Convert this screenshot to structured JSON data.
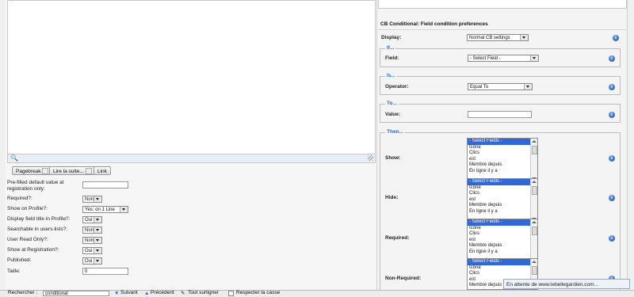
{
  "editor": {
    "buttons": [
      "Pagebreak",
      "Lire la suite...",
      "Link"
    ]
  },
  "left_fields": [
    {
      "label": "Pre-filled default value at registration only:",
      "type": "text",
      "value": ""
    },
    {
      "label": "Required?:",
      "type": "select",
      "value": "Non"
    },
    {
      "label": "Show on Profile?:",
      "type": "select",
      "value": "Yes: on 1 Line"
    },
    {
      "label": "Display field title in Profile?:",
      "type": "select",
      "value": "Oui"
    },
    {
      "label": "Searchable in users-lists?:",
      "type": "select",
      "value": "Non"
    },
    {
      "label": "User Read Only?:",
      "type": "select",
      "value": "Non"
    },
    {
      "label": "Show at Registration?:",
      "type": "select",
      "value": "Oui"
    },
    {
      "label": "Published:",
      "type": "select",
      "value": "Oui"
    },
    {
      "label": "Taille:",
      "type": "text",
      "value": "0"
    }
  ],
  "right": {
    "title": "CB Conditional: Field condition preferences",
    "display_label": "Display:",
    "display_value": "Normal CB settings",
    "if_legend": "If...",
    "field_label": "Field:",
    "field_value": "- Select Field -",
    "is_legend": "Is...",
    "operator_label": "Operator:",
    "operator_value": "Equal To",
    "to_legend": "To...",
    "value_label": "Value:",
    "value_value": "",
    "then_legend": "Then...",
    "lists": [
      {
        "label": "Show:",
        "items": [
          "- Select Fields -",
          "Icône",
          "Clics",
          "est",
          "Membre depuis",
          "En ligne il y a"
        ]
      },
      {
        "label": "Hide:",
        "items": [
          "- Select Fields -",
          "Icône",
          "Clics",
          "est",
          "Membre depuis",
          "En ligne il y a"
        ]
      },
      {
        "label": "Required:",
        "items": [
          "- Select Fields -",
          "Icône",
          "Clics",
          "est",
          "Membre depuis",
          "En ligne il y a"
        ]
      },
      {
        "label": "Non-Required:",
        "items": [
          "- Select Fields -",
          "Icône",
          "Clics",
          "est",
          "Membre depuis"
        ]
      }
    ],
    "info_glyph": "i"
  },
  "status": {
    "loading_text": "En attente de www.lebellegardien.com..."
  },
  "findbar": {
    "label": "Rechercher :",
    "query": "conditional",
    "next": "Suivant",
    "prev": "Précédent",
    "highlight": "Tout surligner",
    "match_case": "Respecter la casse"
  },
  "colors": {
    "legend_blue": "#2d6ac9",
    "selection_blue": "#3068d8",
    "info_blue": "#1d55b8"
  }
}
